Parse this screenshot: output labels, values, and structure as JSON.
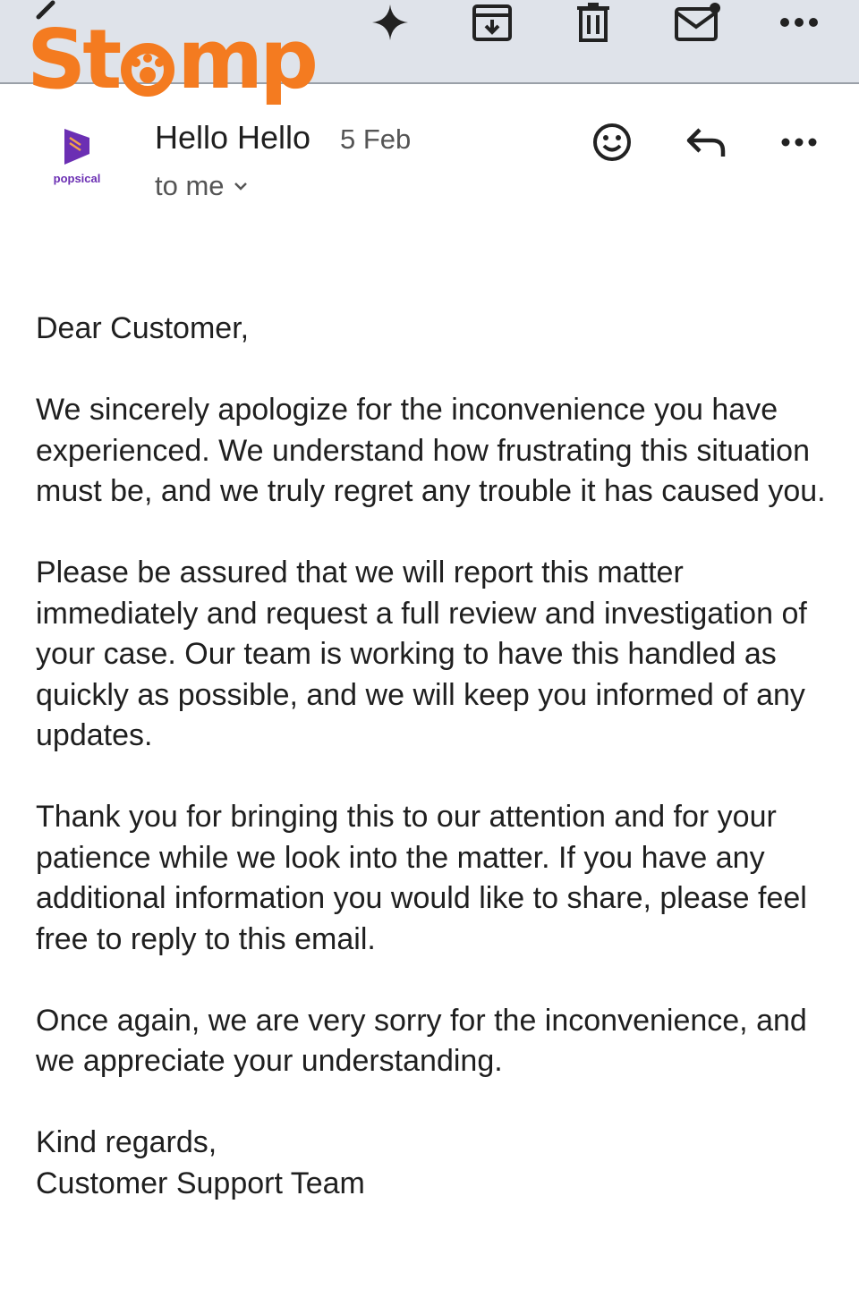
{
  "watermark": {
    "text_left": "St",
    "text_right": "mp"
  },
  "avatar": {
    "label": "popsical",
    "brand_color": "#6b2fb3"
  },
  "header": {
    "sender": "Hello Hello",
    "date": "5 Feb",
    "recipient": "to me"
  },
  "icons": {
    "back": "back-arrow-icon",
    "sparkle": "sparkle-icon",
    "archive": "archive-icon",
    "trash": "trash-icon",
    "mail": "mark-unread-icon",
    "more": "more-icon",
    "emoji": "emoji-icon",
    "reply": "reply-icon"
  },
  "body": {
    "greeting": "Dear Customer,",
    "paragraphs": [
      "We sincerely apologize for the inconvenience you have experienced. We understand how frustrating this situation must be, and we truly regret any trouble it has caused you.",
      "Please be assured that we will report this matter immediately and request a full review and investigation of your case. Our team is working to have this handled as quickly as possible, and we will keep you informed of any updates.",
      "Thank you for bringing this to our attention and for your patience while we look into the matter. If you have any additional information you would like to share, please feel free to reply to this email.",
      "Once again, we are very sorry for the inconvenience, and we appreciate your understanding."
    ],
    "signoff": "Kind regards,",
    "signature": "Customer Support Team"
  }
}
